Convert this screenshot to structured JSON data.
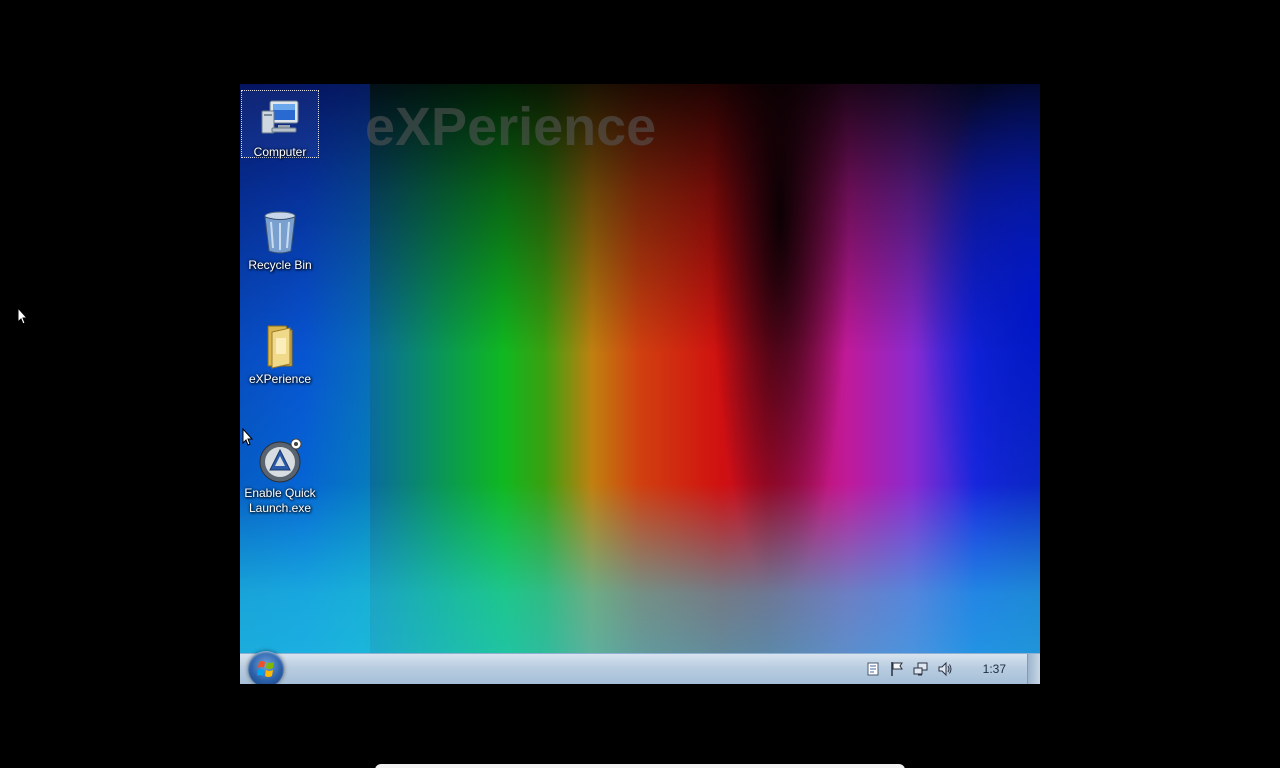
{
  "wallpaper": {
    "title_text": "eXPerience"
  },
  "desktop_icons": [
    {
      "label": "Computer",
      "icon": "computer-icon"
    },
    {
      "label": "Recycle Bin",
      "icon": "recycle-bin-icon"
    },
    {
      "label": "eXPerience",
      "icon": "folder-icon"
    },
    {
      "label": "Enable Quick Launch.exe",
      "icon": "autoit-icon"
    }
  ],
  "taskbar": {
    "start": {
      "icon": "windows-orb-icon"
    },
    "tray_icons": [
      "document-icon",
      "action-center-flag-icon",
      "network-icon",
      "volume-icon"
    ],
    "clock": "1:37"
  },
  "colors": {
    "taskbar_top": "#d7e3ef",
    "taskbar_bottom": "#a6bfd8",
    "frame_background": "#000000"
  }
}
